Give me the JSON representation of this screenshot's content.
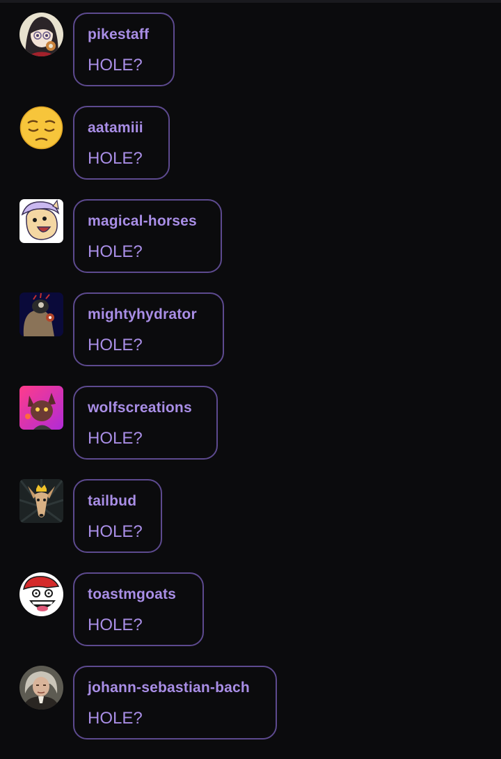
{
  "feed": {
    "items": [
      {
        "username": "pikestaff",
        "message": "HOLE?",
        "avatar_icon": "anime-girl-glasses-avatar"
      },
      {
        "username": "aatamiii",
        "message": "HOLE?",
        "avatar_icon": "pensive-emoji-avatar"
      },
      {
        "username": "magical-horses",
        "message": "HOLE?",
        "avatar_icon": "cartoon-horse-avatar"
      },
      {
        "username": "mightyhydrator",
        "message": "HOLE?",
        "avatar_icon": "dark-creature-avatar"
      },
      {
        "username": "wolfscreations",
        "message": "HOLE?",
        "avatar_icon": "pink-fox-character-avatar"
      },
      {
        "username": "tailbud",
        "message": "HOLE?",
        "avatar_icon": "crowned-deer-avatar"
      },
      {
        "username": "toastmgoats",
        "message": "HOLE?",
        "avatar_icon": "rage-face-avatar"
      },
      {
        "username": "johann-sebastian-bach",
        "message": "HOLE?",
        "avatar_icon": "bach-portrait-avatar"
      }
    ]
  },
  "colors": {
    "background": "#0b0b0d",
    "bubble_border": "#5d4a8f",
    "text_accent": "#a98ee6"
  }
}
